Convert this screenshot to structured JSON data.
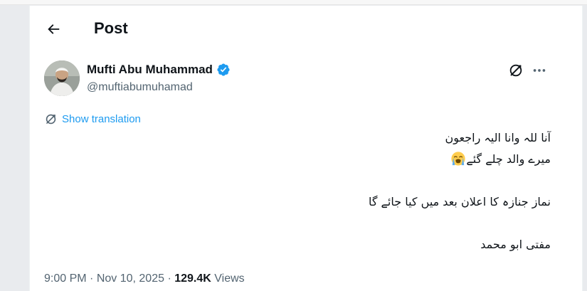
{
  "header": {
    "back_icon": "arrow-left-icon",
    "title": "Post"
  },
  "author": {
    "display_name": "Mufti Abu Muhammad",
    "handle": "@muftiabumuhamad",
    "verified_icon": "verified-badge-icon",
    "verified_color": "#1d9bf0"
  },
  "actions": {
    "grok_icon": "grok-icon",
    "more_icon": "more-horizontal-icon"
  },
  "translation": {
    "icon": "translate-icon",
    "label": "Show translation"
  },
  "tweet": {
    "line1": "آنا للہ وانا الیہ راجعون",
    "line2": "میرے والد چلے گئے",
    "line2_emoji": "loudly-crying-face-emoji",
    "line3": "نماز جنازہ کا اعلان بعد میں کیا جائے گا",
    "line4": "مفتی ابو محمد"
  },
  "meta": {
    "time": "9:00 PM",
    "sep1": " · ",
    "date": "Nov 10, 2025",
    "sep2": " · ",
    "views_count": "129.4K",
    "views_label": " Views"
  },
  "colors": {
    "text_primary": "#0f1419",
    "text_secondary": "#536471",
    "accent": "#1d9bf0"
  }
}
